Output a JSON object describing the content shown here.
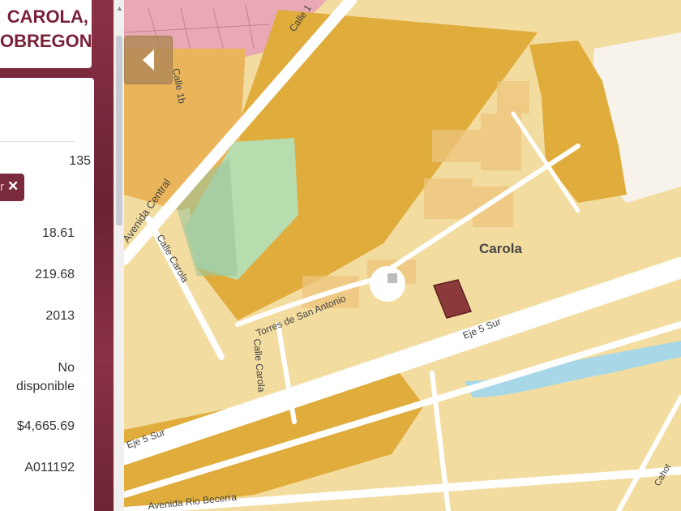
{
  "header": {
    "title_line1": "CAROLA,",
    "title_line2": "OBREGON"
  },
  "info": {
    "count_text": "135",
    "chip_close": "✕",
    "values": [
      "18.61",
      "219.68",
      "2013",
      "No disponible",
      "$4,665.69",
      "A011192"
    ]
  },
  "map": {
    "collapse_icon": "chevron-left-icon",
    "neighborhood_label": "Carola",
    "street_labels": {
      "calle_1": "Calle 1",
      "calle_1b": "Calle 1b",
      "avenida_central": "Avenida Central",
      "calle_carola": "Calle Carola",
      "torres": "Torres de San Antonio",
      "eje5_sur_a": "Eje 5 Sur",
      "eje5_sur_b": "Eje 5 Sur",
      "rio_becerra": "Avenida Rio Becerra",
      "calle_low": "Calle Carola",
      "cahot": "Cahot"
    },
    "colors": {
      "residential": "#f3dca0",
      "commercial": "#e9ae3a",
      "highlight_parcel": "#8b3a3a",
      "park": "#b7dcae",
      "water": "#a8d8e8",
      "road": "#ffffff",
      "sidebar": "#7a2a3c"
    }
  }
}
